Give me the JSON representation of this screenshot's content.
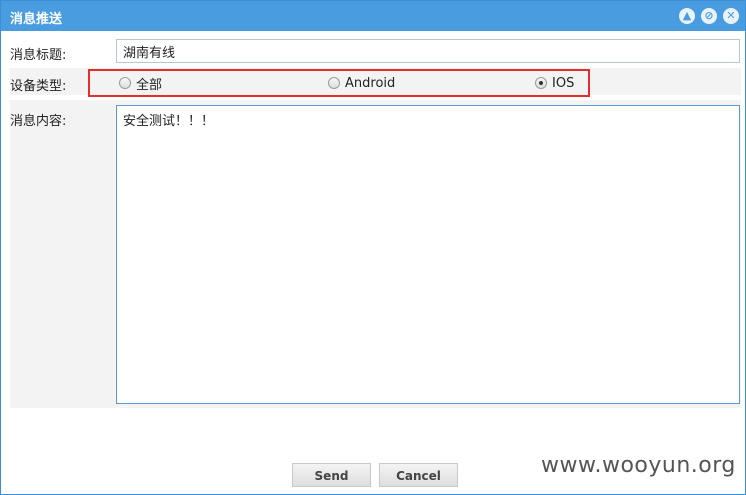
{
  "dialog": {
    "title": "消息推送",
    "buttons": {
      "collapse_icon": "chevron-up-icon",
      "minimize_icon": "minus-circle-icon",
      "close_icon": "close-icon"
    }
  },
  "form": {
    "title_label": "消息标题:",
    "title_value": "湖南有线",
    "device_label": "设备类型:",
    "device_options": [
      {
        "label": "全部",
        "checked": false
      },
      {
        "label": "Android",
        "checked": false
      },
      {
        "label": "IOS",
        "checked": true
      }
    ],
    "content_label": "消息内容:",
    "content_value": "安全测试！！！"
  },
  "actions": {
    "send_label": "Send",
    "cancel_label": "Cancel"
  },
  "watermark": "www.wooyun.org",
  "colors": {
    "titlebar": "#4a9ce0",
    "highlight_box": "#e42d2d"
  }
}
